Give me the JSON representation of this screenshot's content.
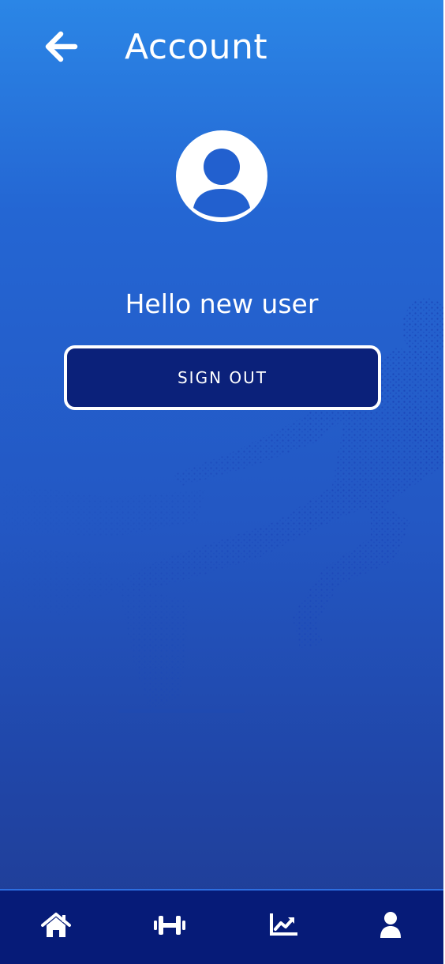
{
  "header": {
    "title": "Account",
    "back_icon": "arrow-left-icon"
  },
  "profile": {
    "avatar_icon": "user-circle-icon",
    "greeting": "Hello new user"
  },
  "actions": {
    "sign_out_label": "SIGN OUT"
  },
  "bottom_nav": {
    "items": [
      {
        "icon": "home-icon"
      },
      {
        "icon": "dumbbell-icon"
      },
      {
        "icon": "chart-line-icon"
      },
      {
        "icon": "user-icon",
        "active": true
      }
    ]
  },
  "colors": {
    "gradient_top": "#2b86e6",
    "gradient_bottom": "#1f3b91",
    "button_bg": "#0b217a",
    "nav_bg": "#061b78",
    "text": "#ffffff"
  }
}
